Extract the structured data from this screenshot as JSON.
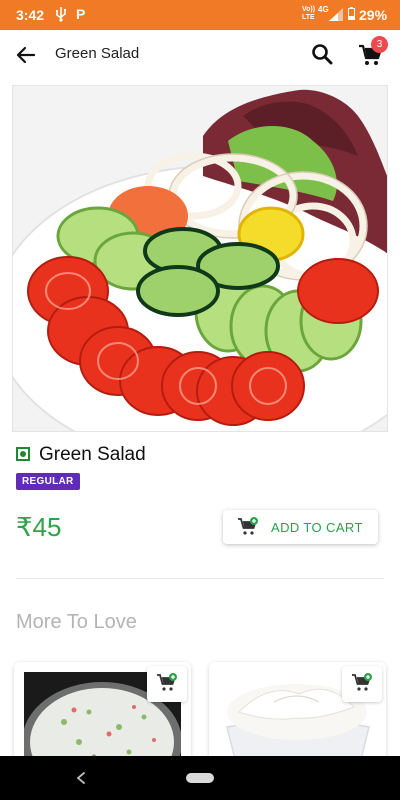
{
  "status_bar": {
    "time": "3:42",
    "p_icon": "P",
    "network_line1": "Vo))",
    "network_line2": "LTE",
    "network_type": "4G",
    "battery": "29%",
    "icons": [
      "usb-icon",
      "signal-icon",
      "battery-icon"
    ],
    "background": "#f07a25"
  },
  "header": {
    "title": "Green Salad",
    "cart_count": "3",
    "icons": [
      "back-arrow-icon",
      "search-icon",
      "cart-icon"
    ]
  },
  "product": {
    "name": "Green Salad",
    "tag": "REGULAR",
    "price": "₹45",
    "add_to_cart_label": "ADD TO CART",
    "veg_color": "#1e8a2f",
    "tag_color": "#5f2bb8",
    "price_color": "#2ea34a"
  },
  "more": {
    "heading": "More To Love",
    "items": [
      {
        "image": "raita-bowl",
        "action_icon": "add-cart-icon"
      },
      {
        "image": "curd-bowl",
        "action_icon": "add-cart-icon"
      }
    ]
  },
  "nav_bar": {
    "icons": [
      "nav-back-icon",
      "home-pill-icon"
    ]
  }
}
